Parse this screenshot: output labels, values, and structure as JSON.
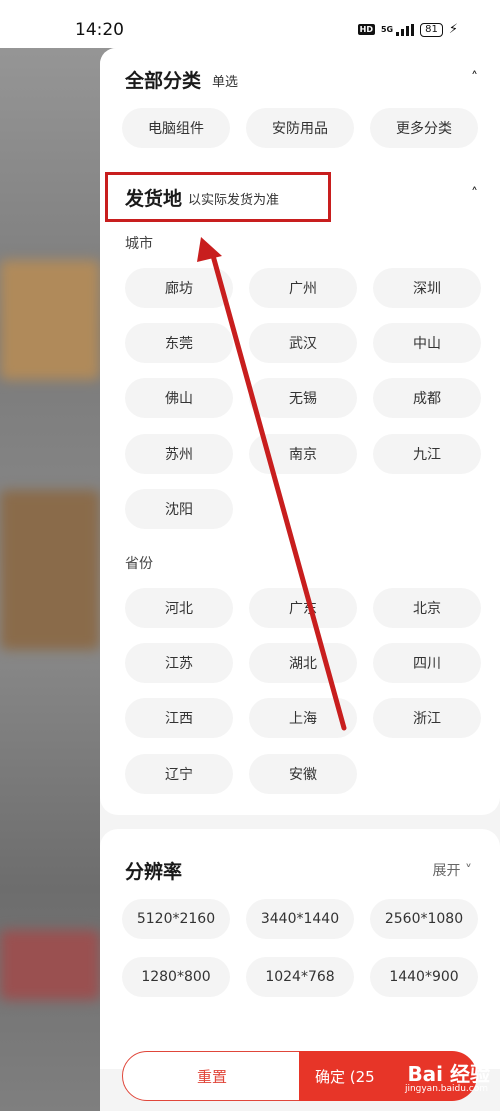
{
  "status": {
    "time": "14:20",
    "hd": "HD",
    "network": "5G",
    "battery": "81"
  },
  "category": {
    "title": "全部分类",
    "subtitle": "单选",
    "chips": [
      "电脑组件",
      "安防用品",
      "更多分类"
    ]
  },
  "shipping": {
    "title": "发货地",
    "subtitle": "以实际发货为准",
    "city_label": "城市",
    "cities": [
      "廊坊",
      "广州",
      "深圳",
      "东莞",
      "武汉",
      "中山",
      "佛山",
      "无锡",
      "成都",
      "苏州",
      "南京",
      "九江",
      "沈阳"
    ],
    "province_label": "省份",
    "provinces": [
      "河北",
      "广东",
      "北京",
      "江苏",
      "湖北",
      "四川",
      "江西",
      "上海",
      "浙江",
      "辽宁",
      "安徽"
    ]
  },
  "resolution": {
    "title": "分辨率",
    "expand_label": "展开",
    "chips": [
      "5120*2160",
      "3440*1440",
      "2560*1080",
      "1280*800",
      "1024*768",
      "1440*900"
    ]
  },
  "footer": {
    "reset_label": "重置",
    "confirm_label": "确定 (25"
  },
  "watermark": {
    "brand": "Bai 经验",
    "url": "jingyan.baidu.com"
  },
  "colors": {
    "accent": "#e73528",
    "annotation": "#c81e1e"
  }
}
